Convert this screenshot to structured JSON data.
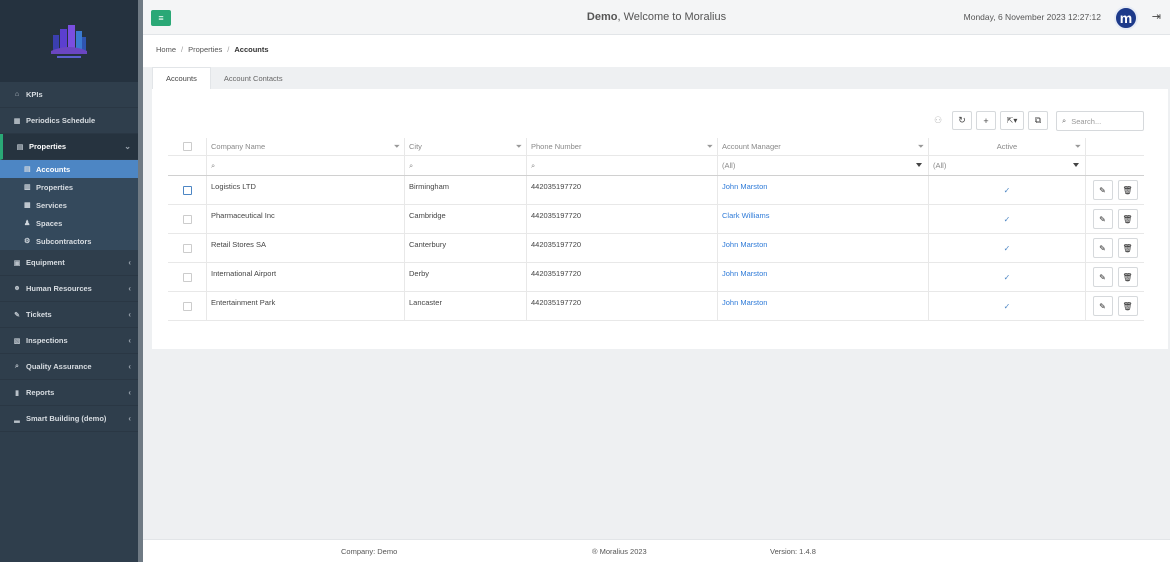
{
  "app": {
    "brand_color": "#2aa876",
    "accent_color": "#4d86c4"
  },
  "sidebar": {
    "items": [
      {
        "label": "KPIs",
        "icon": "home-icon"
      },
      {
        "label": "Periodics Schedule",
        "icon": "calendar-icon"
      },
      {
        "label": "Properties",
        "icon": "building-icon",
        "open": true
      },
      {
        "label": "Equipment",
        "icon": "equipment-icon"
      },
      {
        "label": "Human Resources",
        "icon": "users-icon"
      },
      {
        "label": "Tickets",
        "icon": "wrench-icon"
      },
      {
        "label": "Inspections",
        "icon": "map-icon"
      },
      {
        "label": "Quality Assurance",
        "icon": "search-icon"
      },
      {
        "label": "Reports",
        "icon": "book-icon"
      },
      {
        "label": "Smart Building (demo)",
        "icon": "chart-icon"
      }
    ],
    "properties_sub": [
      {
        "label": "Accounts",
        "icon": "building-icon",
        "active": true
      },
      {
        "label": "Properties",
        "icon": "building-icon"
      },
      {
        "label": "Services",
        "icon": "calendar-icon"
      },
      {
        "label": "Spaces",
        "icon": "pin-icon"
      },
      {
        "label": "Subcontractors",
        "icon": "cogs-icon"
      }
    ]
  },
  "header": {
    "welcome_bold": "Demo",
    "welcome_rest": ", Welcome to Moralius",
    "datetime": "Monday, 6 November 2023 12:27:12",
    "avatar_letter": "m"
  },
  "breadcrumb": {
    "home": "Home",
    "properties": "Properties",
    "current": "Accounts"
  },
  "tabs": {
    "accounts": "Accounts",
    "contacts": "Account Contacts"
  },
  "search": {
    "placeholder": "Search..."
  },
  "grid": {
    "columns": [
      "Company Name",
      "City",
      "Phone Number",
      "Account Manager",
      "Active"
    ],
    "filters": {
      "manager": "(All)",
      "active": "(All)"
    },
    "rows": [
      {
        "company": "Logistics LTD",
        "city": "Birmingham",
        "phone": "442035197720",
        "manager": "John Marston",
        "active": true
      },
      {
        "company": "Pharmaceutical Inc",
        "city": "Cambridge",
        "phone": "442035197720",
        "manager": "Clark Williams",
        "active": true
      },
      {
        "company": "Retail Stores SA",
        "city": "Canterbury",
        "phone": "442035197720",
        "manager": "John Marston",
        "active": true
      },
      {
        "company": "International Airport",
        "city": "Derby",
        "phone": "442035197720",
        "manager": "John Marston",
        "active": true
      },
      {
        "company": "Entertainment Park",
        "city": "Lancaster",
        "phone": "442035197720",
        "manager": "John Marston",
        "active": true
      }
    ]
  },
  "footer": {
    "company": "Company: Demo",
    "copyright": "® Moralius 2023",
    "version": "Version: 1.4.8"
  }
}
